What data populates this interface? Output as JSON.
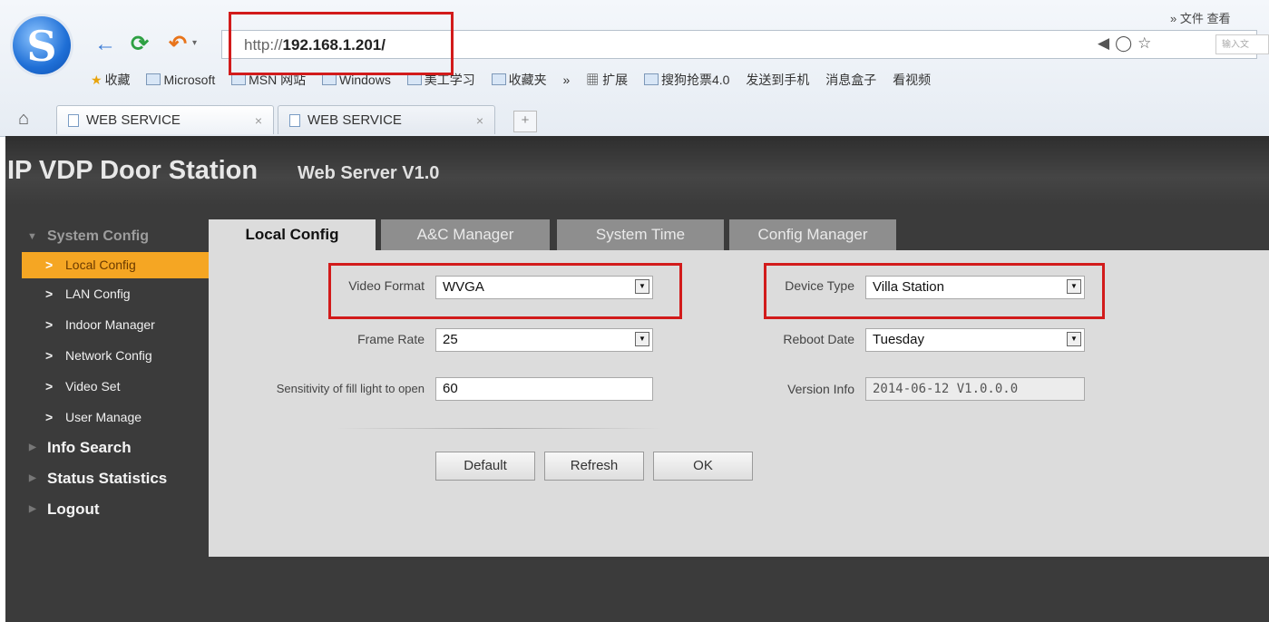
{
  "browser": {
    "url_protocol": "http://",
    "url_host": "192.168.1.201/",
    "top_menu": "» 文件 查看",
    "search_placeholder": "输入文",
    "favorites": [
      "收藏",
      "Microsoft",
      "MSN 网站",
      "Windows",
      "美工学习",
      "收藏夹",
      "»",
      "扩展",
      "搜狗抢票4.0",
      "发送到手机",
      "消息盒子",
      "看视频"
    ],
    "tabs": [
      {
        "label": "WEB SERVICE"
      },
      {
        "label": "WEB SERVICE"
      }
    ],
    "new_tab": "+"
  },
  "app": {
    "title": "IP VDP Door Station",
    "subtitle": "Web Server V1.0"
  },
  "sidebar": {
    "section": "System Config",
    "items": [
      "Local Config",
      "LAN Config",
      "Indoor Manager",
      "Network Config",
      "Video Set",
      "User Manage"
    ],
    "main": [
      "Info Search",
      "Status Statistics",
      "Logout"
    ]
  },
  "tabs": [
    "Local Config",
    "A&C Manager",
    "System Time",
    "Config Manager"
  ],
  "form": {
    "video_format": {
      "label": "Video Format",
      "value": "WVGA"
    },
    "frame_rate": {
      "label": "Frame Rate",
      "value": "25"
    },
    "sensitivity": {
      "label": "Sensitivity of fill light to open",
      "value": "60"
    },
    "device_type": {
      "label": "Device Type",
      "value": "Villa Station"
    },
    "reboot_date": {
      "label": "Reboot Date",
      "value": "Tuesday"
    },
    "version_info": {
      "label": "Version Info",
      "value": "2014-06-12 V1.0.0.0"
    }
  },
  "buttons": {
    "default": "Default",
    "refresh": "Refresh",
    "ok": "OK"
  },
  "colors": {
    "active_menu": "#f5a623",
    "highlight_box": "#d21b1b"
  }
}
